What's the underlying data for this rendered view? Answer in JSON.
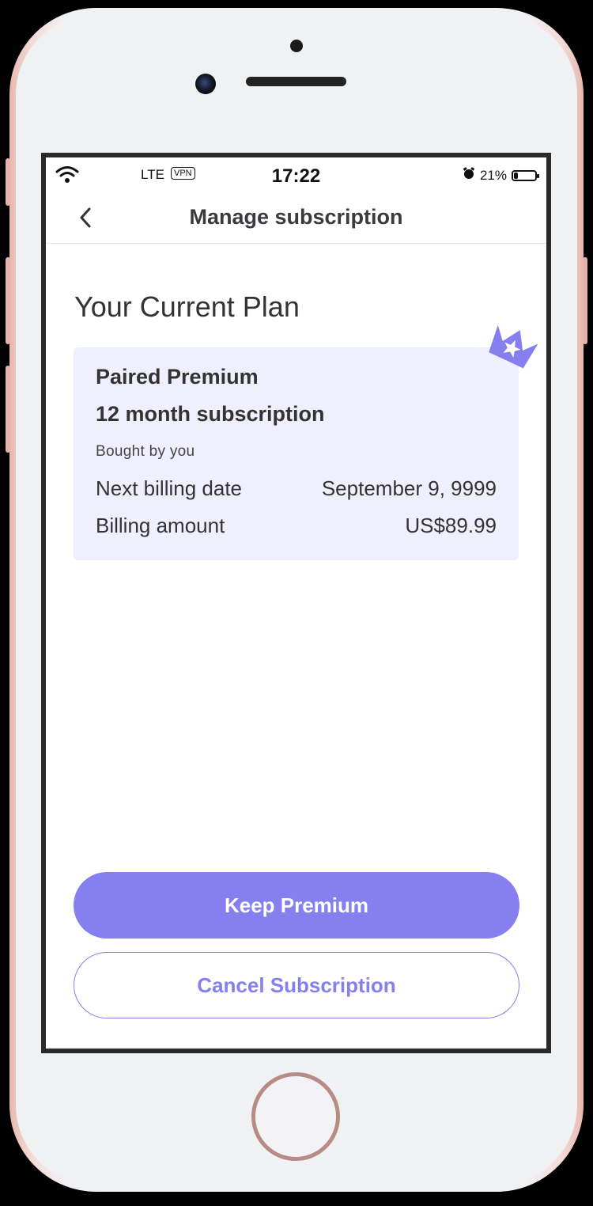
{
  "status_bar": {
    "carrier": "LTE",
    "vpn": "VPN",
    "time": "17:22",
    "battery": "21%",
    "battery_level": 0.21
  },
  "nav": {
    "title": "Manage subscription",
    "back_icon": "chevron-left-icon"
  },
  "main": {
    "section_title": "Your Current Plan",
    "plan": {
      "name": "Paired Premium",
      "duration": "12 month subscription",
      "owner": "Bought by you",
      "rows": [
        {
          "label": "Next billing date",
          "value": "September 9, 9999"
        },
        {
          "label": "Billing amount",
          "value": "US$89.99"
        }
      ],
      "badge_icon": "crown-icon"
    }
  },
  "actions": {
    "keep_label": "Keep Premium",
    "cancel_label": "Cancel Subscription"
  },
  "colors": {
    "accent": "#857fef",
    "card_bg": "#efeffe"
  }
}
